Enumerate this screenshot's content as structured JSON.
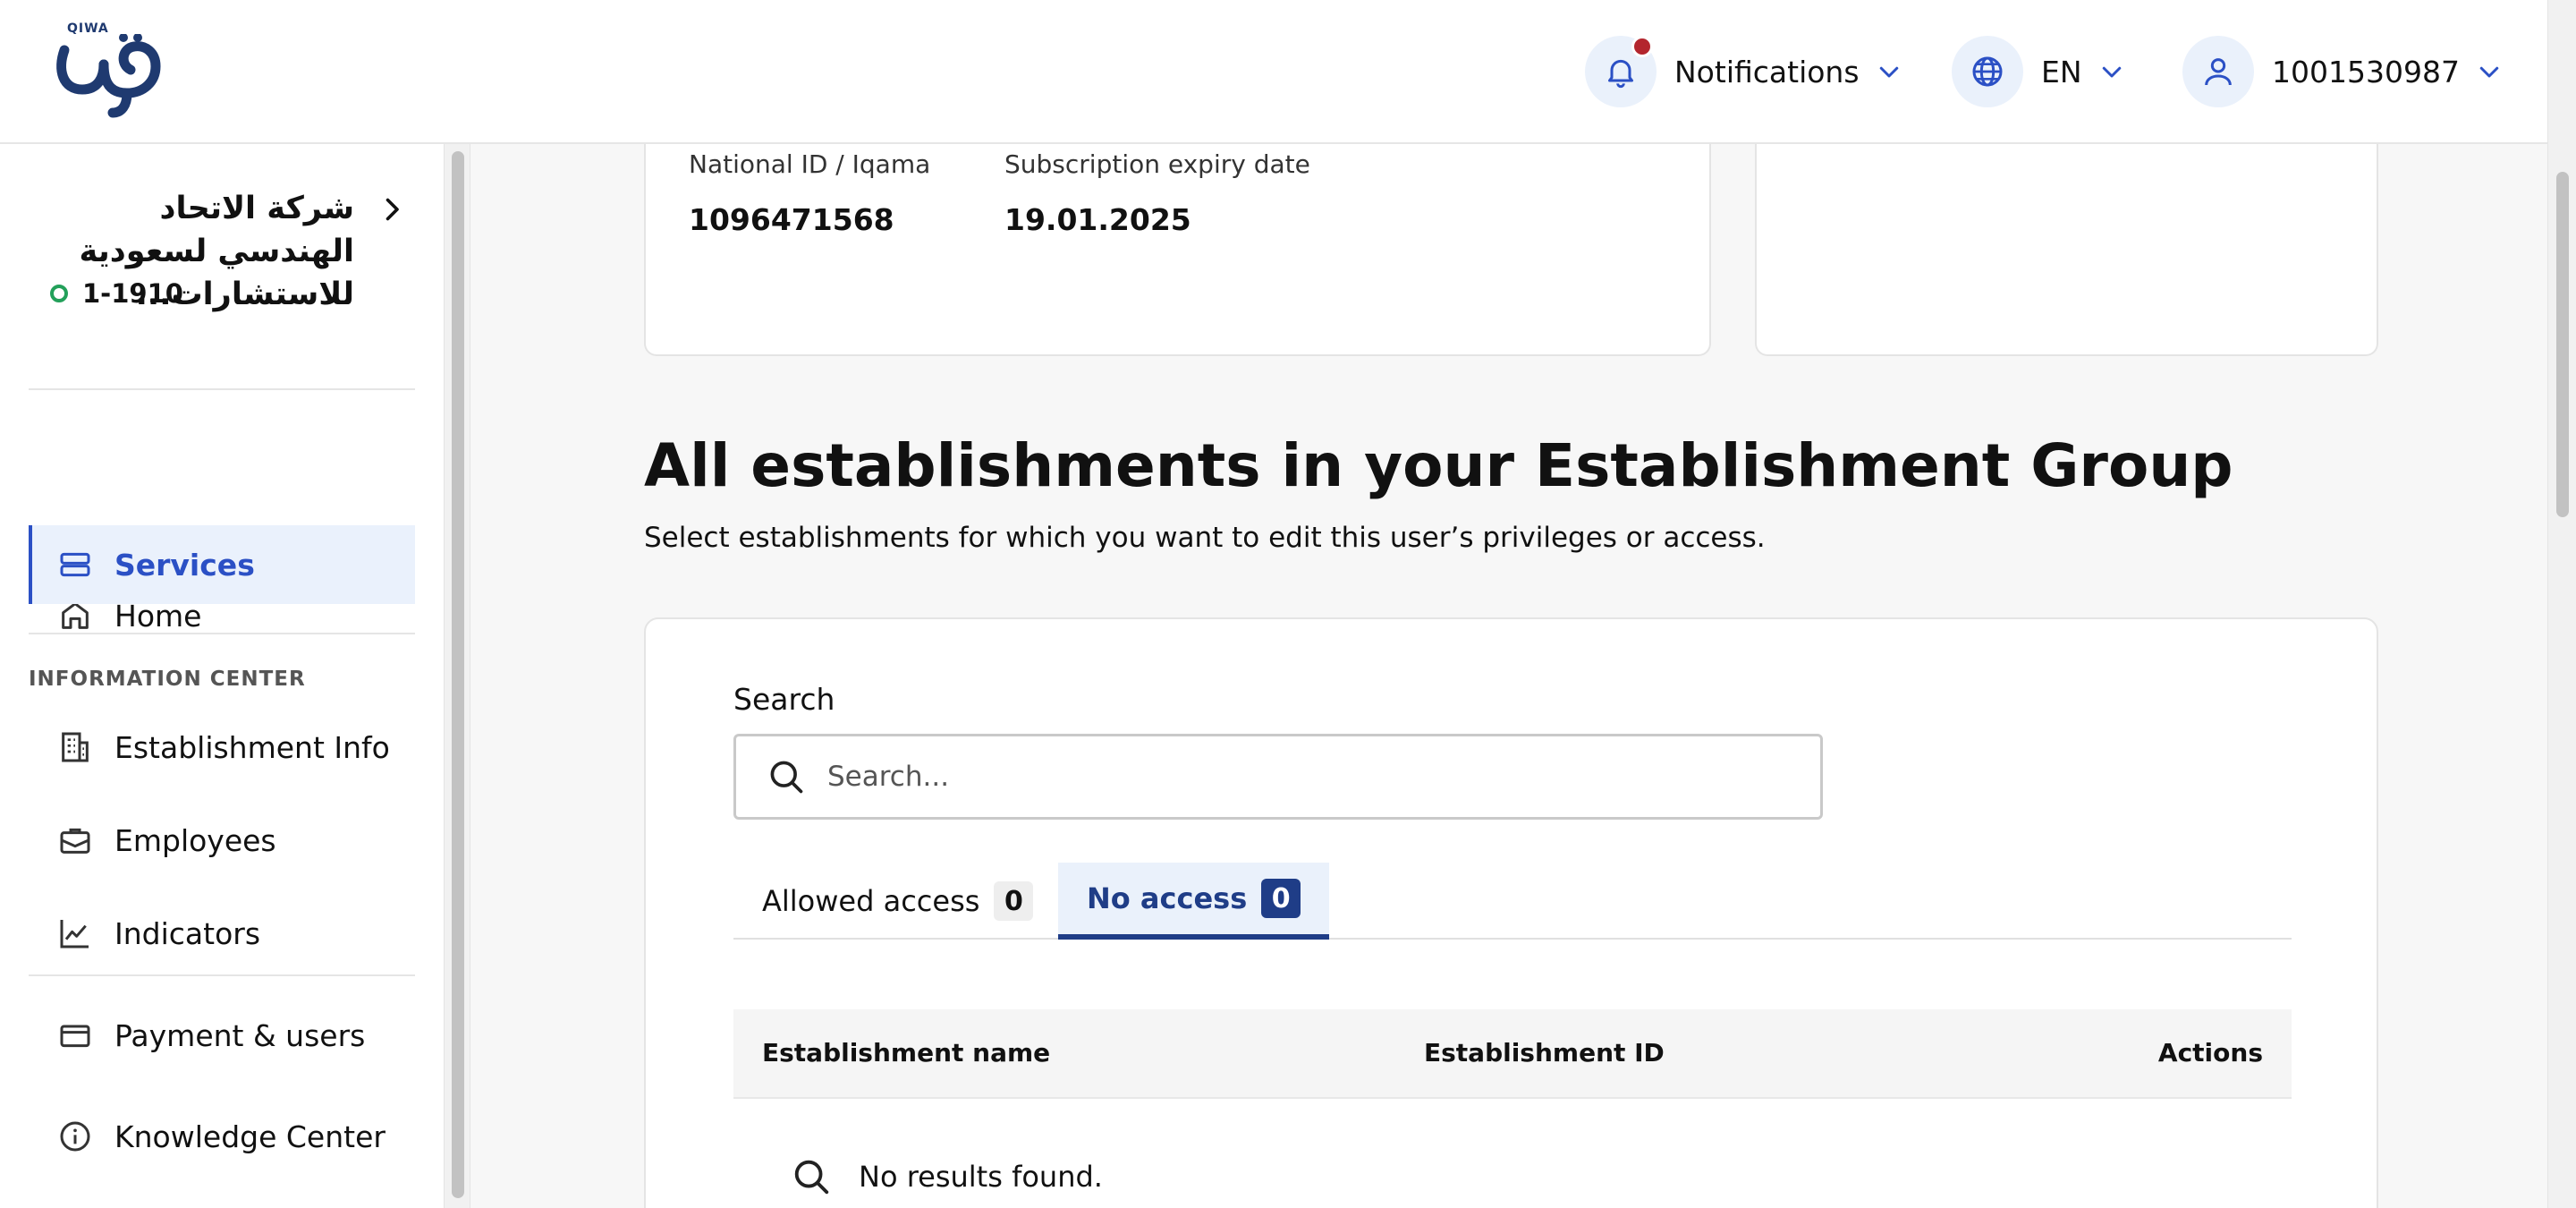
{
  "header": {
    "logo_small": "QIWA",
    "notifications_label": "Notifications",
    "language_label": "EN",
    "user_id": "1001530987"
  },
  "sidebar": {
    "company_name": "شركة الاتحاد الهندسي لسعودية للاستشارات...",
    "company_id": "1-1910",
    "nav_items": [
      {
        "label": "Home",
        "icon": "home-icon"
      },
      {
        "label": "Services",
        "icon": "services-icon",
        "active": true
      }
    ],
    "section_label": "INFORMATION CENTER",
    "info_items": [
      {
        "label": "Establishment Info",
        "icon": "building-icon"
      },
      {
        "label": "Employees",
        "icon": "briefcase-icon"
      },
      {
        "label": "Indicators",
        "icon": "chart-icon"
      }
    ],
    "bottom_items": [
      {
        "label": "Payment & users",
        "icon": "card-icon"
      },
      {
        "label": "Knowledge Center",
        "icon": "info-icon"
      }
    ]
  },
  "user_card": {
    "national_id_label": "National ID / Iqama",
    "national_id_value": "1096471568",
    "expiry_label": "Subscription expiry date",
    "expiry_value": "19.01.2025"
  },
  "main": {
    "title": "All establishments in your Establishment Group",
    "subtitle": "Select establishments for which you want to edit this user’s privileges or access.",
    "search_label": "Search",
    "search_placeholder": "Search...",
    "tabs": [
      {
        "label": "Allowed access",
        "count": "0"
      },
      {
        "label": "No access",
        "count": "0",
        "active": true
      }
    ],
    "table_headers": [
      "Establishment name",
      "Establishment ID",
      "Actions"
    ],
    "empty_message": "No results found."
  },
  "colors": {
    "accent": "#2b50c5",
    "active_tab": "#1f3d87",
    "notification_dot": "#b3262e",
    "status_active": "#23a05a"
  }
}
